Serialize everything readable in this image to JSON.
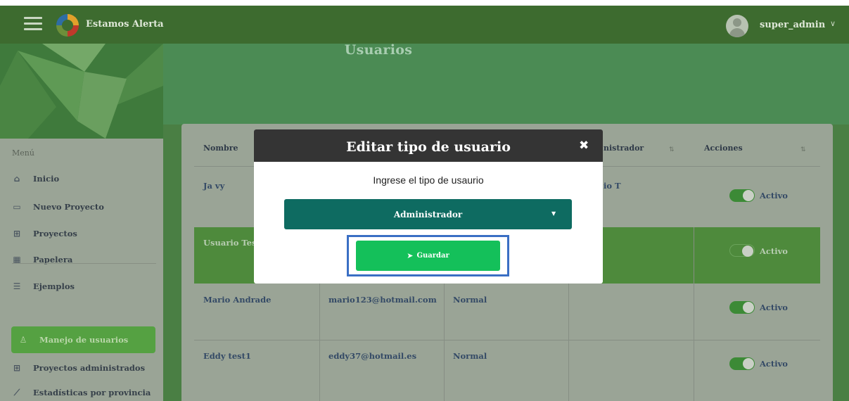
{
  "topbar": {
    "brand": "Estamos Alerta",
    "user_name": "super_admin",
    "user_chevron": "∨"
  },
  "sidebar": {
    "menu_title": "Menú",
    "items": [
      {
        "label": "Inicio",
        "icon": "home-icon"
      },
      {
        "label": "Nuevo Proyecto",
        "icon": "new-project-icon"
      },
      {
        "label": "Proyectos",
        "icon": "grid-icon"
      },
      {
        "label": "Papelera",
        "icon": "trash-grid-icon"
      },
      {
        "label": "Ejemplos",
        "icon": "list-icon"
      },
      {
        "label": "Manejo de usuarios",
        "icon": "user-icon",
        "active": true
      },
      {
        "label": "Proyectos administrados",
        "icon": "grid-icon"
      },
      {
        "label": "Estadísticas por provincia",
        "icon": "chart-icon"
      }
    ]
  },
  "page": {
    "title": "Usuarios"
  },
  "table": {
    "headers": [
      "Nombre",
      "nistrador",
      "Acciones"
    ],
    "rows": [
      {
        "name": "Ja vy",
        "email": "",
        "type": "",
        "admin": "io T",
        "status": "Activo"
      },
      {
        "name": "Usuario Tes",
        "email": "",
        "type": "",
        "admin": "",
        "status": "Activo"
      },
      {
        "name": "Mario Andrade",
        "email": "mario123@hotmail.com",
        "type": "Normal",
        "admin": "",
        "status": "Activo"
      },
      {
        "name": "Eddy test1",
        "email": "eddy37@hotmail.es",
        "type": "Normal",
        "admin": "",
        "status": "Activo"
      }
    ]
  },
  "modal": {
    "title": "Editar tipo de usuario",
    "close": "✖",
    "prompt": "Ingrese el tipo de usaurio",
    "select_value": "Administrador",
    "save_label": "Guardar"
  },
  "colors": {
    "topbar": "#3d6b2f",
    "modal_header": "#343434",
    "select_bg": "#0e6b61",
    "save_button": "#14c05a",
    "highlight": "#3a6fc4"
  }
}
